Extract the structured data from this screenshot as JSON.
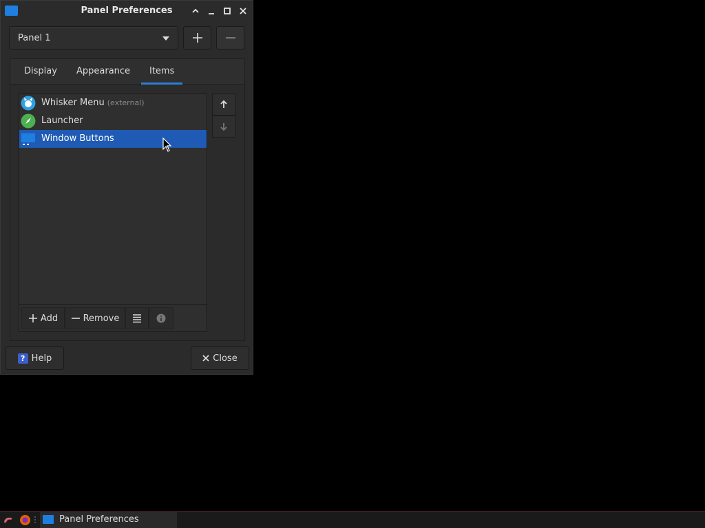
{
  "window": {
    "title": "Panel Preferences"
  },
  "panel_selector": {
    "selected": "Panel 1"
  },
  "tabs": [
    {
      "label": "Display",
      "active": false
    },
    {
      "label": "Appearance",
      "active": false
    },
    {
      "label": "Items",
      "active": true
    }
  ],
  "items": [
    {
      "label": "Whisker Menu",
      "note": "(external)",
      "icon": "whisker-menu-icon",
      "selected": false
    },
    {
      "label": "Launcher",
      "note": "",
      "icon": "launcher-icon",
      "selected": false
    },
    {
      "label": "Window Buttons",
      "note": "",
      "icon": "window-buttons-icon",
      "selected": true
    }
  ],
  "item_toolbar": {
    "add_label": "Add",
    "remove_label": "Remove"
  },
  "footer": {
    "help_label": "Help",
    "close_label": "Close"
  },
  "taskbar": {
    "task_label": "Panel Preferences"
  },
  "colors": {
    "selection": "#1f5bb5",
    "tab_underline": "#2d7fd6",
    "accent_blue": "#1e7fe0"
  }
}
